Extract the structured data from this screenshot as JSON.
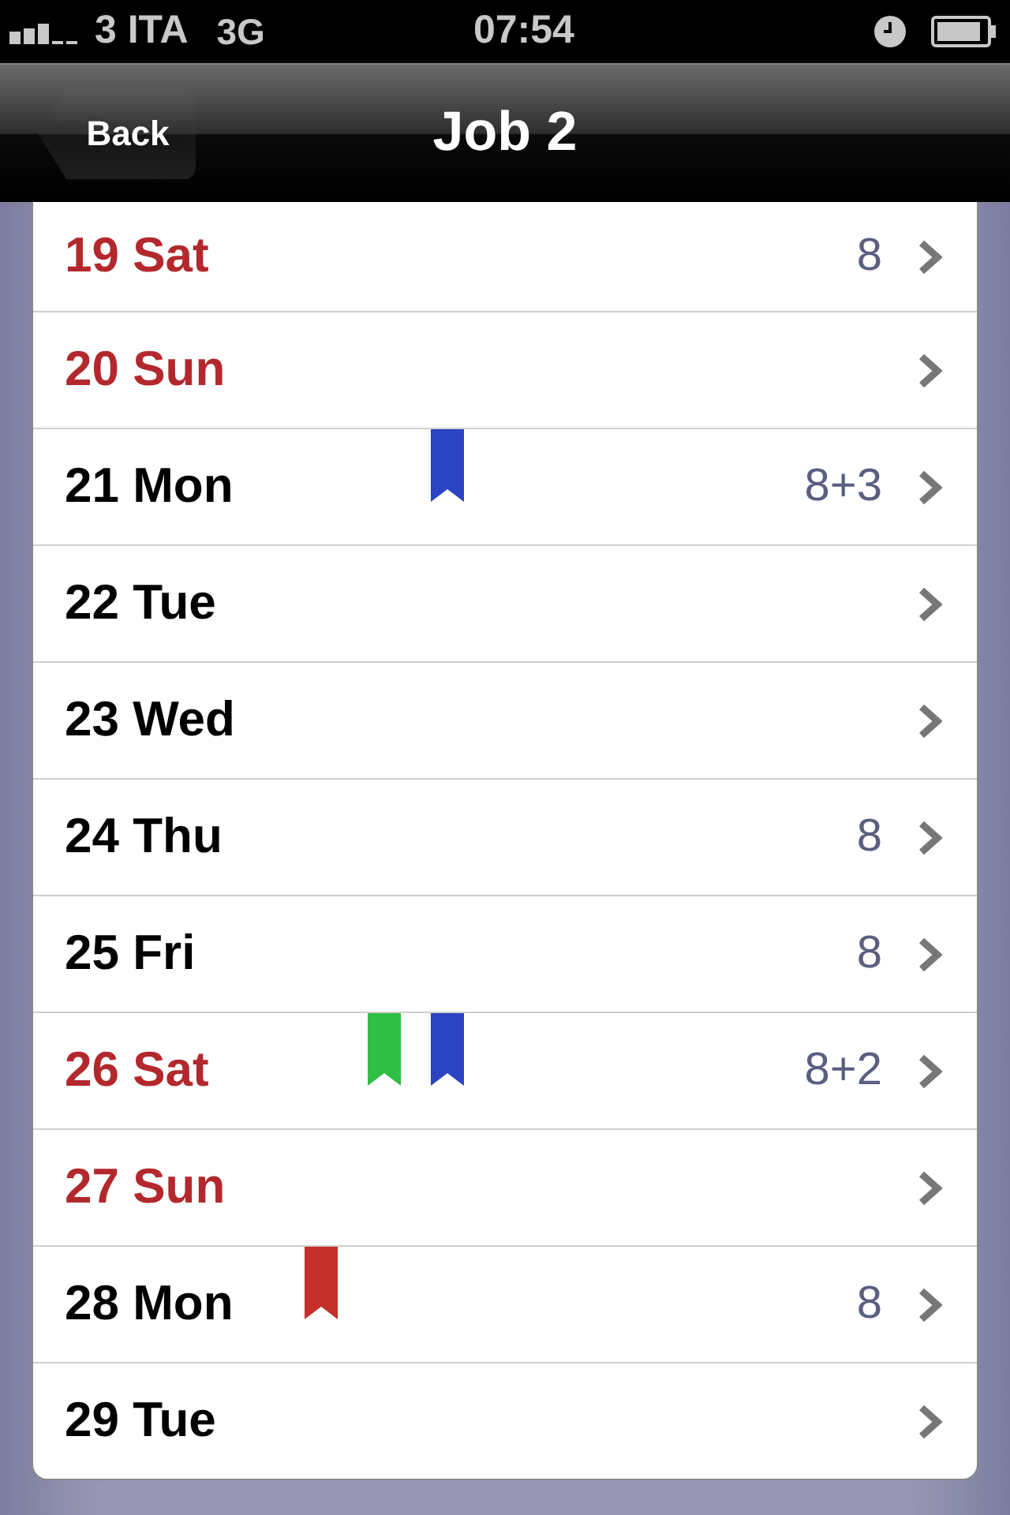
{
  "status_bar": {
    "carrier": "3 ITA",
    "network": "3G",
    "time": "07:54"
  },
  "nav_bar": {
    "back": "Back",
    "title": "Job 2"
  },
  "days": [
    {
      "label": "19 Sat",
      "weekend": true,
      "hours": "8"
    },
    {
      "label": "20 Sun",
      "weekend": true
    },
    {
      "label": "21 Mon",
      "weekend": false,
      "hours": "8+3",
      "flags": [
        {
          "kind": "right",
          "color": "#2a44c4"
        }
      ]
    },
    {
      "label": "22 Tue",
      "weekend": false
    },
    {
      "label": "23 Wed",
      "weekend": false
    },
    {
      "label": "24 Thu",
      "weekend": false,
      "hours": "8"
    },
    {
      "label": "25 Fri",
      "weekend": false,
      "hours": "8"
    },
    {
      "label": "26 Sat",
      "weekend": true,
      "hours": "8+2",
      "flags": [
        {
          "kind": "middle",
          "color": "#2fbf45"
        },
        {
          "kind": "right",
          "color": "#2a44c4"
        }
      ]
    },
    {
      "label": "27 Sun",
      "weekend": true
    },
    {
      "label": "28 Mon",
      "weekend": false,
      "hours": "8",
      "flags": [
        {
          "kind": "left",
          "color": "#c4302a"
        }
      ]
    },
    {
      "label": "29 Tue",
      "weekend": false
    }
  ]
}
